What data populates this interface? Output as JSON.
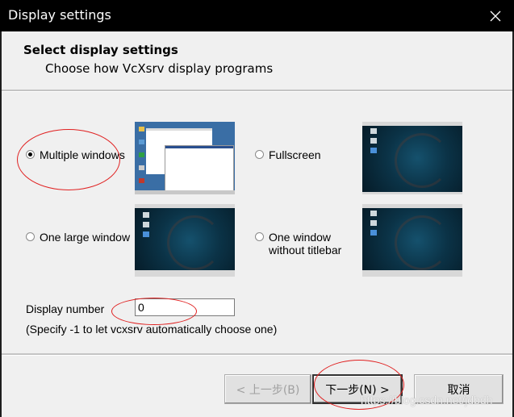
{
  "window": {
    "title": "Display settings",
    "close_icon": "close-icon"
  },
  "header": {
    "title": "Select display settings",
    "subtitle": "Choose how VcXsrv display programs"
  },
  "options": [
    {
      "label": "Multiple windows",
      "selected": true,
      "preview": "multiple-windows-preview"
    },
    {
      "label": "Fullscreen",
      "selected": false,
      "preview": "fullscreen-preview"
    },
    {
      "label": "One large window",
      "selected": false,
      "preview": "one-large-window-preview"
    },
    {
      "label_line1": "One window",
      "label_line2": "without titlebar",
      "selected": false,
      "preview": "one-window-without-titlebar-preview"
    }
  ],
  "display_number": {
    "label": "Display number",
    "value": "0",
    "hint": "(Specify -1 to let vcxsrv automatically choose one)"
  },
  "buttons": {
    "back": "< 上一步(B)",
    "next": "下一步(N) >",
    "cancel": "取消"
  },
  "watermark": "https://blog.csdn.net/jdbdh",
  "annotation_color": "#e02020"
}
